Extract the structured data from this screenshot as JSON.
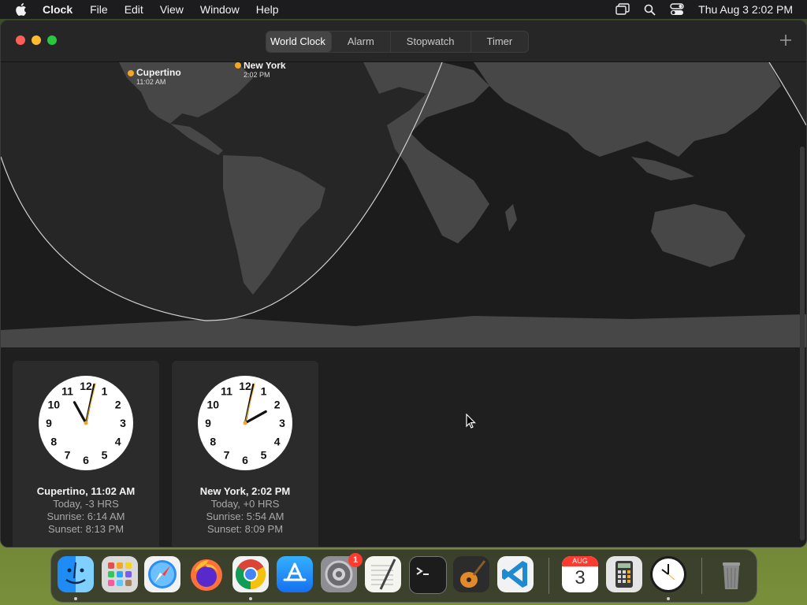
{
  "menubar": {
    "app_name": "Clock",
    "items": [
      "File",
      "Edit",
      "View",
      "Window",
      "Help"
    ],
    "datetime": "Thu Aug 3  2:02 PM"
  },
  "toolbar": {
    "tabs": [
      "World Clock",
      "Alarm",
      "Stopwatch",
      "Timer"
    ],
    "active_tab": "World Clock"
  },
  "map": {
    "pins": [
      {
        "name": "Cupertino",
        "time": "11:02 AM"
      },
      {
        "name": "New York",
        "time": "2:02 PM"
      }
    ],
    "pin_color": "#f5a623"
  },
  "clocks": [
    {
      "title": "Cupertino, 11:02 AM",
      "offset": "Today, -3 HRS",
      "sunrise": "Sunrise: 6:14 AM",
      "sunset": "Sunset: 8:13 PM",
      "hour": 11,
      "minute": 2
    },
    {
      "title": "New York, 2:02 PM",
      "offset": "Today, +0 HRS",
      "sunrise": "Sunrise: 5:54 AM",
      "sunset": "Sunset: 8:09 PM",
      "hour": 2,
      "minute": 2
    }
  ],
  "dock": {
    "calendar_month": "AUG",
    "calendar_day": "3",
    "settings_badge": "1"
  }
}
